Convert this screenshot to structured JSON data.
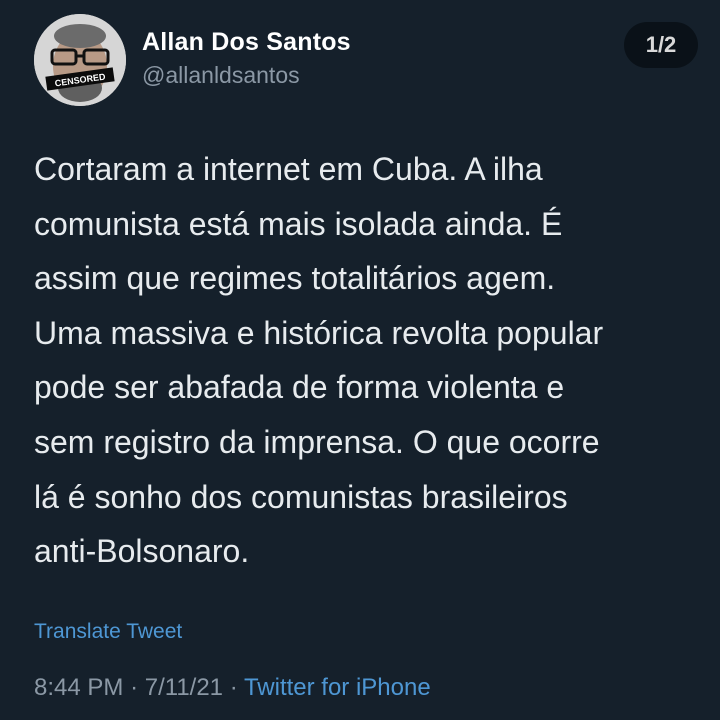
{
  "author": {
    "display_name": "Allan Dos Santos",
    "handle": "@allanldsantos",
    "avatar_label": "CENSORED"
  },
  "thread": {
    "page_indicator": "1/2"
  },
  "tweet": {
    "lines": [
      "Cortaram a internet em Cuba. A ilha",
      "comunista está mais isolada ainda. É",
      "assim que regimes totalitários agem.",
      "Uma massiva e histórica revolta popular",
      "pode ser abafada de forma violenta e",
      "sem registro da imprensa. O que ocorre",
      "lá é sonho dos comunistas brasileiros",
      "anti-Bolsonaro."
    ],
    "translate_label": "Translate Tweet",
    "time": "8:44 PM",
    "separator": "·",
    "date": "7/11/21",
    "source": "Twitter for iPhone"
  },
  "colors": {
    "background": "#15202b",
    "text": "#e7ebee",
    "secondary": "#8b98a5",
    "link": "#4e97d4"
  }
}
